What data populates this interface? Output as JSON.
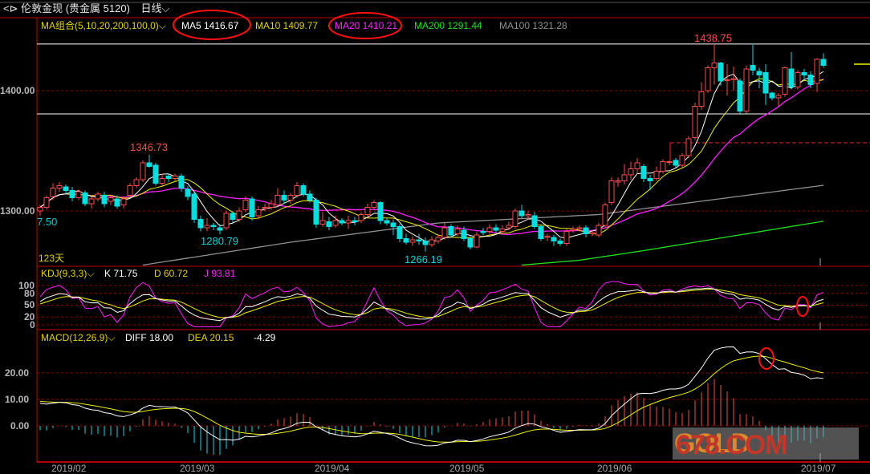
{
  "header": {
    "title": "伦敦金现 (贵金属 5120)",
    "period": "日线",
    "period_icon": "chevron-down-icon"
  },
  "ma_legend": {
    "group": "MA组合(5,10,20,200,100,0)",
    "ma5": "MA5 1416.67",
    "ma10": "MA10 1409.77",
    "ma20": "MA20 1410.21",
    "ma200": "MA200 1291.44",
    "ma100": "MA100 1321.28"
  },
  "price_axis": {
    "labels": [
      "1400.00",
      "1300.00"
    ],
    "left_cut_label": "7.50",
    "days_label": "123天"
  },
  "annotations": {
    "high1": "1346.73",
    "low1": "1280.79",
    "low2": "1266.19",
    "high2": "1438.75"
  },
  "kdj_legend": {
    "name": "KDJ(9,3,3)",
    "k": "K 71.75",
    "d": "D 60.72",
    "j": "J 93.81",
    "ticks": [
      "100",
      "80",
      "50",
      "20",
      "0"
    ]
  },
  "macd_legend": {
    "name": "MACD(12,26,9)",
    "diff": "DIFF 18.00",
    "dea": "DEA 20.15",
    "macd": "-4.29",
    "ticks": [
      "20.00",
      "10.00",
      "0.00"
    ]
  },
  "x_axis": {
    "labels": [
      "2019/02",
      "2019/03",
      "2019/04",
      "2019/05",
      "2019/06",
      "2019/07"
    ],
    "label_bar_index": [
      4,
      24,
      45,
      66,
      89,
      122
    ]
  },
  "watermark": {
    "a": "GOLD",
    "b": "678.COM"
  },
  "colors": {
    "up": "#ff4a4a",
    "down": "#00e0e0",
    "ma5": "#ffffff",
    "ma10": "#f0f000",
    "ma20": "#ff20ff",
    "ma100": "#909090",
    "ma200": "#20e020",
    "frame": "#c00000",
    "grid": "#8a0000"
  },
  "chart_data": {
    "type": "candlestick",
    "bars": 123,
    "ylim": [
      1245,
      1440
    ],
    "ohlc": [
      [
        1300,
        1305,
        1296,
        1303
      ],
      [
        1303,
        1313,
        1301,
        1311
      ],
      [
        1312,
        1323,
        1309,
        1319
      ],
      [
        1319,
        1324,
        1316,
        1321
      ],
      [
        1320,
        1322,
        1314,
        1317
      ],
      [
        1317,
        1320,
        1308,
        1311
      ],
      [
        1311,
        1318,
        1309,
        1316
      ],
      [
        1315,
        1317,
        1304,
        1306
      ],
      [
        1306,
        1312,
        1302,
        1310
      ],
      [
        1310,
        1316,
        1308,
        1314
      ],
      [
        1313,
        1316,
        1303,
        1306
      ],
      [
        1308,
        1313,
        1305,
        1311
      ],
      [
        1310,
        1313,
        1302,
        1304
      ],
      [
        1305,
        1312,
        1302,
        1310
      ],
      [
        1313,
        1323,
        1311,
        1321
      ],
      [
        1321,
        1328,
        1319,
        1326
      ],
      [
        1326,
        1342,
        1324,
        1340
      ],
      [
        1340,
        1346.73,
        1336,
        1337
      ],
      [
        1338,
        1340,
        1321,
        1323
      ],
      [
        1323,
        1331,
        1321,
        1327
      ],
      [
        1329,
        1331,
        1324,
        1327
      ],
      [
        1327,
        1331,
        1325,
        1329
      ],
      [
        1329,
        1331,
        1316,
        1319
      ],
      [
        1318,
        1321,
        1309,
        1312
      ],
      [
        1314,
        1316,
        1290,
        1293
      ],
      [
        1293,
        1296,
        1283,
        1286
      ],
      [
        1286,
        1294,
        1283,
        1288
      ],
      [
        1288,
        1290,
        1284,
        1287
      ],
      [
        1286,
        1289,
        1280.79,
        1284
      ],
      [
        1286,
        1300,
        1284,
        1298
      ],
      [
        1298,
        1300,
        1289,
        1293
      ],
      [
        1293,
        1303,
        1291,
        1300
      ],
      [
        1301,
        1312,
        1299,
        1309
      ],
      [
        1310,
        1312,
        1292,
        1295
      ],
      [
        1296,
        1304,
        1293,
        1301
      ],
      [
        1302,
        1306,
        1300,
        1303
      ],
      [
        1303,
        1309,
        1301,
        1306
      ],
      [
        1305,
        1319,
        1303,
        1313
      ],
      [
        1313,
        1317,
        1306,
        1309
      ],
      [
        1309,
        1315,
        1306,
        1313
      ],
      [
        1313,
        1324,
        1311,
        1321
      ],
      [
        1321,
        1323,
        1312,
        1314
      ],
      [
        1314,
        1317,
        1307,
        1309
      ],
      [
        1309,
        1311,
        1286,
        1289
      ],
      [
        1289,
        1299,
        1287,
        1292
      ],
      [
        1291,
        1295,
        1284,
        1287
      ],
      [
        1288,
        1296,
        1286,
        1292
      ],
      [
        1292,
        1294,
        1288,
        1290
      ],
      [
        1290,
        1296,
        1285,
        1292
      ],
      [
        1292,
        1295,
        1288,
        1291
      ],
      [
        1292,
        1299,
        1290,
        1297
      ],
      [
        1297,
        1306,
        1295,
        1303
      ],
      [
        1303,
        1309,
        1301,
        1307
      ],
      [
        1307,
        1308,
        1289,
        1292
      ],
      [
        1292,
        1294,
        1288,
        1290
      ],
      [
        1290,
        1293,
        1280,
        1287
      ],
      [
        1287,
        1289,
        1274,
        1277
      ],
      [
        1277,
        1281,
        1272,
        1274
      ],
      [
        1274,
        1279,
        1271,
        1276
      ],
      [
        1276,
        1281,
        1272,
        1275
      ],
      [
        1275,
        1278,
        1266.19,
        1272
      ],
      [
        1272,
        1279,
        1270,
        1276
      ],
      [
        1275,
        1281,
        1273,
        1278
      ],
      [
        1278,
        1290,
        1276,
        1286
      ],
      [
        1287,
        1289,
        1278,
        1280
      ],
      [
        1281,
        1288,
        1279,
        1285
      ],
      [
        1284,
        1287,
        1275,
        1277
      ],
      [
        1277,
        1279,
        1268,
        1270
      ],
      [
        1270,
        1283,
        1269,
        1280
      ],
      [
        1283,
        1286,
        1280,
        1282
      ],
      [
        1283,
        1289,
        1281,
        1286
      ],
      [
        1286,
        1289,
        1282,
        1284
      ],
      [
        1283,
        1288,
        1281,
        1285
      ],
      [
        1286,
        1291,
        1284,
        1288
      ],
      [
        1287,
        1302,
        1285,
        1300
      ],
      [
        1300,
        1305,
        1294,
        1296
      ],
      [
        1296,
        1300,
        1293,
        1297
      ],
      [
        1296,
        1299,
        1285,
        1287
      ],
      [
        1287,
        1289,
        1275,
        1277
      ],
      [
        1278,
        1281,
        1275,
        1279
      ],
      [
        1278,
        1280,
        1271,
        1275
      ],
      [
        1275,
        1277,
        1271,
        1273
      ],
      [
        1273,
        1285,
        1271,
        1283
      ],
      [
        1284,
        1287,
        1282,
        1285
      ],
      [
        1285,
        1288,
        1283,
        1286
      ],
      [
        1286,
        1288,
        1278,
        1281
      ],
      [
        1281,
        1284,
        1279,
        1282
      ],
      [
        1280,
        1290,
        1278,
        1288
      ],
      [
        1288,
        1307,
        1286,
        1305
      ],
      [
        1307,
        1328,
        1305,
        1325
      ],
      [
        1324,
        1328,
        1320,
        1325
      ],
      [
        1325,
        1339,
        1322,
        1330
      ],
      [
        1330,
        1341,
        1326,
        1335
      ],
      [
        1335,
        1344,
        1331,
        1340
      ],
      [
        1337,
        1339,
        1324,
        1327
      ],
      [
        1327,
        1330,
        1317,
        1325
      ],
      [
        1327,
        1337,
        1325,
        1333
      ],
      [
        1333,
        1343,
        1331,
        1341
      ],
      [
        1341,
        1342,
        1338,
        1341
      ],
      [
        1342,
        1344,
        1336,
        1338
      ],
      [
        1338,
        1348,
        1336,
        1346
      ],
      [
        1346,
        1362,
        1344,
        1360
      ],
      [
        1361,
        1390,
        1359,
        1387
      ],
      [
        1387,
        1407,
        1384,
        1399
      ],
      [
        1400,
        1421,
        1398,
        1419
      ],
      [
        1419,
        1438.75,
        1405,
        1423
      ],
      [
        1423,
        1424,
        1404,
        1408
      ],
      [
        1409,
        1422,
        1396,
        1409
      ],
      [
        1409,
        1420,
        1400,
        1410
      ],
      [
        1408,
        1410,
        1380,
        1383
      ],
      [
        1383,
        1421,
        1381,
        1418
      ],
      [
        1421,
        1439,
        1413,
        1417
      ],
      [
        1416,
        1419,
        1402,
        1413
      ],
      [
        1415,
        1422,
        1388,
        1398
      ],
      [
        1398,
        1399,
        1392,
        1394
      ],
      [
        1394,
        1398,
        1387,
        1396
      ],
      [
        1397,
        1420,
        1395,
        1419
      ],
      [
        1418,
        1432,
        1401,
        1403
      ],
      [
        1403,
        1417,
        1401,
        1415
      ],
      [
        1415,
        1418,
        1410,
        1413
      ],
      [
        1413,
        1416,
        1402,
        1405
      ],
      [
        1406,
        1427,
        1399,
        1426
      ],
      [
        1426,
        1431,
        1419,
        1421
      ]
    ],
    "ma100_points": [
      [
        16,
        1255
      ],
      [
        39,
        1274
      ],
      [
        62,
        1290
      ],
      [
        87,
        1297
      ],
      [
        122,
        1321.28
      ]
    ],
    "ma200_points": [
      [
        75,
        1255
      ],
      [
        84,
        1259
      ],
      [
        94,
        1267
      ],
      [
        122,
        1291.44
      ]
    ],
    "hlines": {
      "high_line": 1438.75,
      "low_line": 1380.7,
      "dashed_level": 1356.7,
      "last_price": 1422
    },
    "kdj_grid": [
      100,
      80,
      50,
      20,
      0
    ],
    "macd_grid": [
      20,
      10,
      0
    ]
  }
}
